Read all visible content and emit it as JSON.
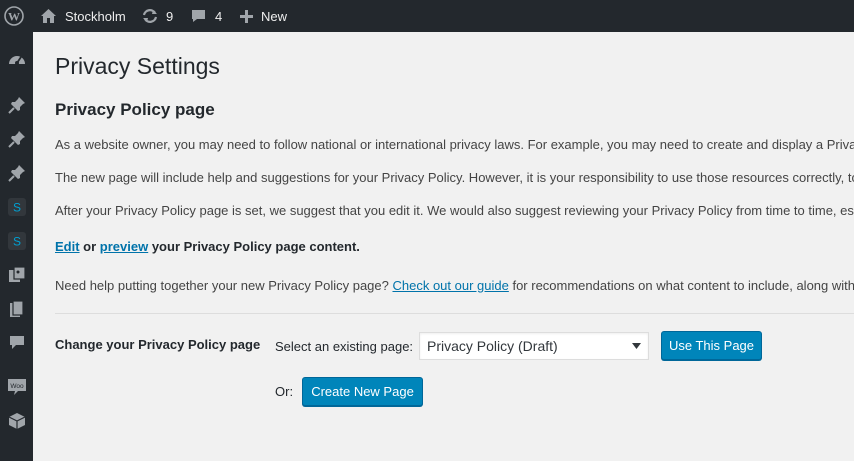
{
  "admin_bar": {
    "wp_logo_icon": "wordpress-logo-icon",
    "site_name": "Stockholm",
    "updates_count": "9",
    "comments_count": "4",
    "new_label": "New"
  },
  "sidebar": {
    "items": [
      {
        "icon": "dashboard-icon"
      },
      {
        "icon": "pin-icon"
      },
      {
        "icon": "pin-icon"
      },
      {
        "icon": "pin-icon"
      },
      {
        "icon": "s-plugin-icon",
        "glyph": "S"
      },
      {
        "icon": "s-plugin-icon",
        "glyph": "S"
      },
      {
        "icon": "media-icon"
      },
      {
        "icon": "pages-icon"
      },
      {
        "icon": "comments-icon"
      },
      {
        "icon": "woocommerce-icon",
        "glyph": "Woo"
      },
      {
        "icon": "products-icon"
      }
    ]
  },
  "page": {
    "title": "Privacy Settings",
    "section_title": "Privacy Policy page",
    "para1": "As a website owner, you may need to follow national or international privacy laws. For example, you may need to create and display a Privacy Policy.",
    "para2": "The new page will include help and suggestions for your Privacy Policy. However, it is your responsibility to use those resources correctly, to provide the information that your Privacy Policy requires, and to keep that information current and accurate.",
    "para3": "After your Privacy Policy page is set, we suggest that you edit it. We would also suggest reviewing your Privacy Policy from time to time, especially after installing or updating any themes or plugins.",
    "edit_link": "Edit",
    "or_text": " or ",
    "preview_link": "preview",
    "edit_suffix": " your Privacy Policy page content.",
    "help_prefix": "Need help putting together your new Privacy Policy page? ",
    "guide_link": "Check out our guide",
    "help_suffix": " for recommendations on what content to include, along with policies suggested by your plugins and theme."
  },
  "form": {
    "row_label": "Change your Privacy Policy page",
    "select_label": "Select an existing page:",
    "selected_page": "Privacy Policy (Draft)",
    "use_button": "Use This Page",
    "or_label": "Or:",
    "create_button": "Create New Page"
  },
  "colors": {
    "admin_bar_bg": "#23282d",
    "link": "#0073aa",
    "primary_button": "#0085ba",
    "background": "#f1f1f1"
  }
}
